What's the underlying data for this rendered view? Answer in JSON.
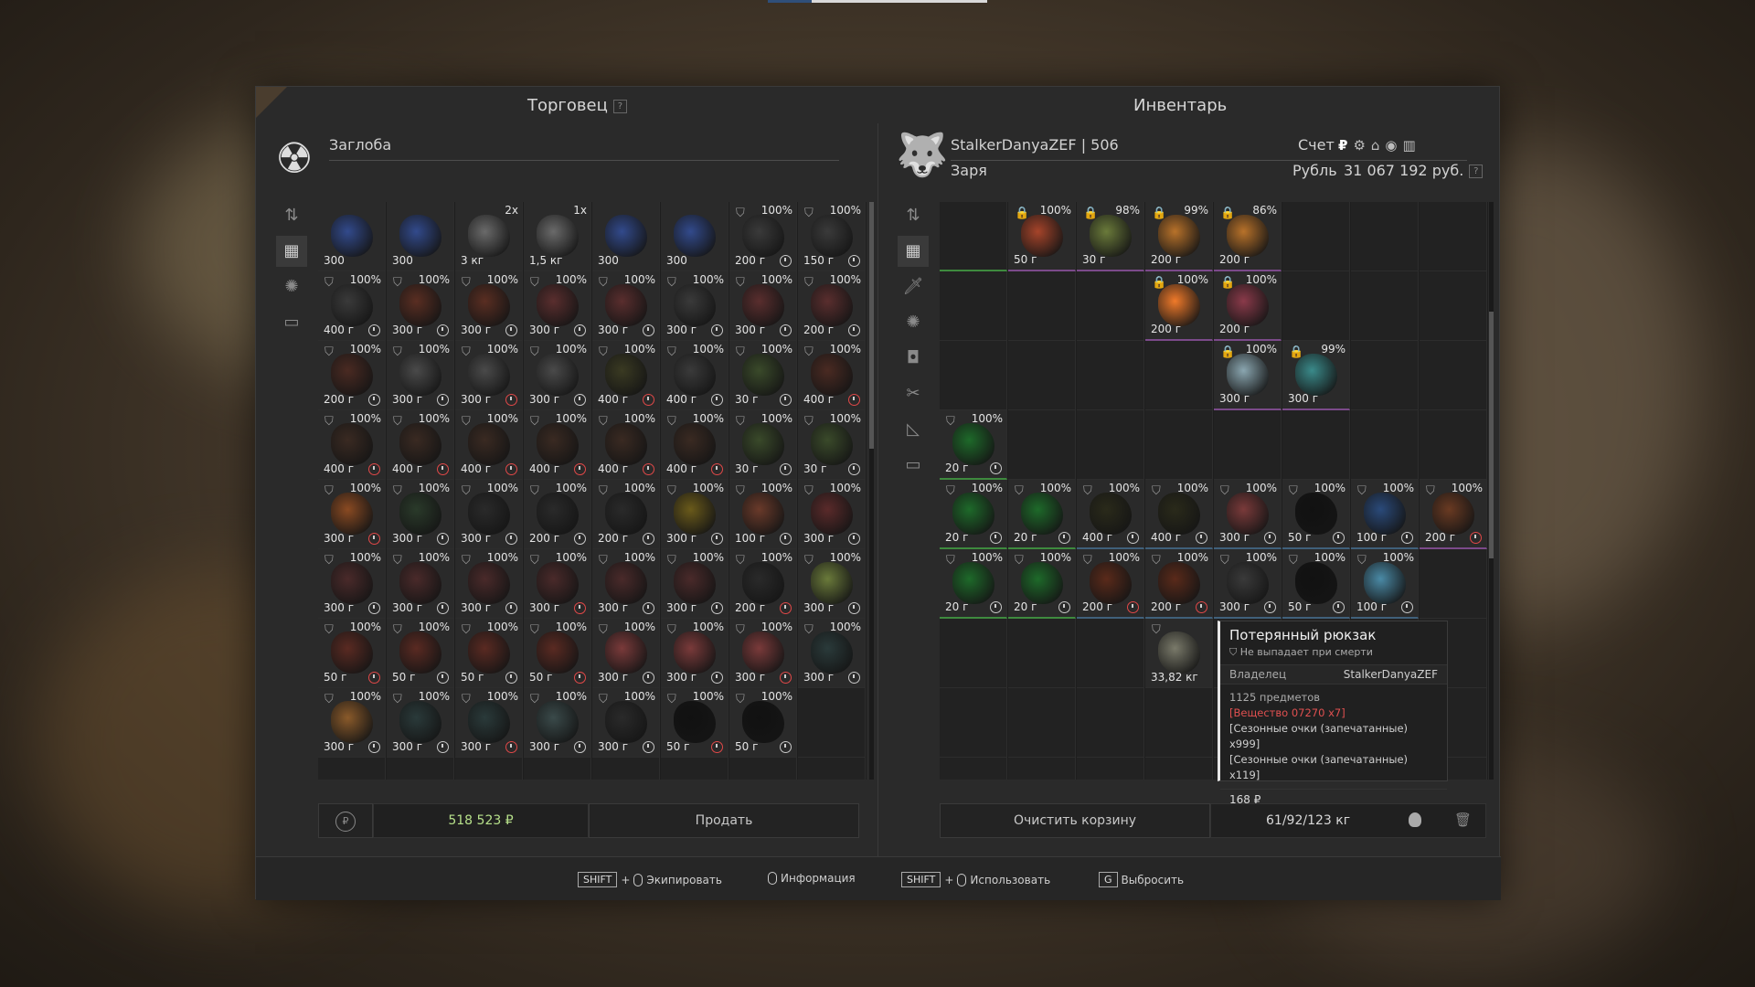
{
  "top_tabs": {
    "left_color": "#2f4f7a",
    "right_color": "#d9d9d9"
  },
  "trader": {
    "panel_title": "Торговец",
    "help": "?",
    "name": "Заглоба",
    "avatar_icon": "radiation-icon",
    "money": "518 523 ₽",
    "sell_label": "Продать",
    "side_icons": [
      "sort-icon",
      "grid-icon",
      "artifact-icon",
      "box-icon"
    ],
    "items": [
      {
        "pct": "",
        "wt": "300",
        "shield": false,
        "color": "#324a8c",
        "clock": ""
      },
      {
        "pct": "",
        "wt": "300",
        "shield": false,
        "color": "#324a8c",
        "clock": ""
      },
      {
        "pct": "2x",
        "wt": "3 кг",
        "shield": false,
        "color": "#6a6a6a",
        "clock": ""
      },
      {
        "pct": "1x",
        "wt": "1,5 кг",
        "shield": false,
        "color": "#6a6a6a",
        "clock": ""
      },
      {
        "pct": "",
        "wt": "300",
        "shield": false,
        "color": "#324a8c",
        "clock": ""
      },
      {
        "pct": "",
        "wt": "300",
        "shield": false,
        "color": "#324a8c",
        "clock": ""
      },
      {
        "pct": "100%",
        "wt": "200 г",
        "shield": true,
        "color": "#3a3a3a",
        "clock": "w"
      },
      {
        "pct": "100%",
        "wt": "150 г",
        "shield": true,
        "color": "#3a3a3a",
        "clock": "w"
      },
      {
        "pct": "100%",
        "wt": "400 г",
        "shield": true,
        "color": "#3a3a3a",
        "clock": "w"
      },
      {
        "pct": "100%",
        "wt": "300 г",
        "shield": true,
        "color": "#5a2e22",
        "clock": "w"
      },
      {
        "pct": "100%",
        "wt": "300 г",
        "shield": true,
        "color": "#5a2e22",
        "clock": "w"
      },
      {
        "pct": "100%",
        "wt": "300 г",
        "shield": true,
        "color": "#5a2e2e",
        "clock": "w"
      },
      {
        "pct": "100%",
        "wt": "300 г",
        "shield": true,
        "color": "#5a2e2e",
        "clock": "w"
      },
      {
        "pct": "100%",
        "wt": "300 г",
        "shield": true,
        "color": "#3a3a3a",
        "clock": "w"
      },
      {
        "pct": "100%",
        "wt": "300 г",
        "shield": true,
        "color": "#5a2e2e",
        "clock": "w"
      },
      {
        "pct": "100%",
        "wt": "200 г",
        "shield": true,
        "color": "#5a2e2e",
        "clock": "w"
      },
      {
        "pct": "100%",
        "wt": "200 г",
        "shield": true,
        "color": "#4a2a22",
        "clock": "w"
      },
      {
        "pct": "100%",
        "wt": "300 г",
        "shield": true,
        "color": "#4a4a4a",
        "clock": "w"
      },
      {
        "pct": "100%",
        "wt": "300 г",
        "shield": true,
        "color": "#4a4a4a",
        "clock": "r"
      },
      {
        "pct": "100%",
        "wt": "300 г",
        "shield": true,
        "color": "#4a4a4a",
        "clock": "w"
      },
      {
        "pct": "100%",
        "wt": "400 г",
        "shield": true,
        "color": "#3a3a22",
        "clock": "r"
      },
      {
        "pct": "100%",
        "wt": "400 г",
        "shield": true,
        "color": "#3a3a3a",
        "clock": "w"
      },
      {
        "pct": "100%",
        "wt": "30 г",
        "shield": true,
        "color": "#3a4a2a",
        "clock": "w"
      },
      {
        "pct": "100%",
        "wt": "400 г",
        "shield": true,
        "color": "#4a2a22",
        "clock": "r"
      },
      {
        "pct": "100%",
        "wt": "400 г",
        "shield": true,
        "color": "#3a2a22",
        "clock": "r"
      },
      {
        "pct": "100%",
        "wt": "400 г",
        "shield": true,
        "color": "#3a2a22",
        "clock": "r"
      },
      {
        "pct": "100%",
        "wt": "400 г",
        "shield": true,
        "color": "#3a2a22",
        "clock": "r"
      },
      {
        "pct": "100%",
        "wt": "400 г",
        "shield": true,
        "color": "#3a2a22",
        "clock": "r"
      },
      {
        "pct": "100%",
        "wt": "400 г",
        "shield": true,
        "color": "#3a2a22",
        "clock": "r"
      },
      {
        "pct": "100%",
        "wt": "400 г",
        "shield": true,
        "color": "#3a2a22",
        "clock": "r"
      },
      {
        "pct": "100%",
        "wt": "30 г",
        "shield": true,
        "color": "#3a4a2a",
        "clock": "w"
      },
      {
        "pct": "100%",
        "wt": "30 г",
        "shield": true,
        "color": "#3a4a2a",
        "clock": "w"
      },
      {
        "pct": "100%",
        "wt": "300 г",
        "shield": true,
        "color": "#8a4a22",
        "clock": "r"
      },
      {
        "pct": "100%",
        "wt": "300 г",
        "shield": true,
        "color": "#2a3a2a",
        "clock": "w"
      },
      {
        "pct": "100%",
        "wt": "300 г",
        "shield": true,
        "color": "#2a2a2a",
        "clock": "w"
      },
      {
        "pct": "100%",
        "wt": "200 г",
        "shield": true,
        "color": "#2a2a2a",
        "clock": "w"
      },
      {
        "pct": "100%",
        "wt": "200 г",
        "shield": true,
        "color": "#2a2a2a",
        "clock": "w"
      },
      {
        "pct": "100%",
        "wt": "300 г",
        "shield": true,
        "color": "#6a5a1a",
        "clock": "w"
      },
      {
        "pct": "100%",
        "wt": "100 г",
        "shield": true,
        "color": "#6a3a2a",
        "clock": "w"
      },
      {
        "pct": "100%",
        "wt": "300 г",
        "shield": true,
        "color": "#5a2a2a",
        "clock": "w"
      },
      {
        "pct": "100%",
        "wt": "300 г",
        "shield": true,
        "color": "#4a2a2a",
        "clock": "w"
      },
      {
        "pct": "100%",
        "wt": "300 г",
        "shield": true,
        "color": "#4a2a2a",
        "clock": "w"
      },
      {
        "pct": "100%",
        "wt": "300 г",
        "shield": true,
        "color": "#4a2a2a",
        "clock": "w"
      },
      {
        "pct": "100%",
        "wt": "300 г",
        "shield": true,
        "color": "#4a2a2a",
        "clock": "r"
      },
      {
        "pct": "100%",
        "wt": "300 г",
        "shield": true,
        "color": "#4a2a2a",
        "clock": "w"
      },
      {
        "pct": "100%",
        "wt": "300 г",
        "shield": true,
        "color": "#4a2a2a",
        "clock": "w"
      },
      {
        "pct": "100%",
        "wt": "200 г",
        "shield": true,
        "color": "#2a2a2a",
        "clock": "r"
      },
      {
        "pct": "100%",
        "wt": "300 г",
        "shield": true,
        "color": "#6a7a3a",
        "clock": "w"
      },
      {
        "pct": "100%",
        "wt": "50 г",
        "shield": true,
        "color": "#5a2a22",
        "clock": "r"
      },
      {
        "pct": "100%",
        "wt": "50 г",
        "shield": true,
        "color": "#5a2a22",
        "clock": "w"
      },
      {
        "pct": "100%",
        "wt": "50 г",
        "shield": true,
        "color": "#5a2a22",
        "clock": "w"
      },
      {
        "pct": "100%",
        "wt": "50 г",
        "shield": true,
        "color": "#5a2a22",
        "clock": "r"
      },
      {
        "pct": "100%",
        "wt": "300 г",
        "shield": true,
        "color": "#7a3a3a",
        "clock": "w"
      },
      {
        "pct": "100%",
        "wt": "300 г",
        "shield": true,
        "color": "#7a3a3a",
        "clock": "w"
      },
      {
        "pct": "100%",
        "wt": "300 г",
        "shield": true,
        "color": "#7a3a3a",
        "clock": "r"
      },
      {
        "pct": "100%",
        "wt": "300 г",
        "shield": true,
        "color": "#2a3a3a",
        "clock": "w"
      },
      {
        "pct": "100%",
        "wt": "300 г",
        "shield": true,
        "color": "#8a5a2a",
        "clock": "w"
      },
      {
        "pct": "100%",
        "wt": "300 г",
        "shield": true,
        "color": "#2a3a3a",
        "clock": "w"
      },
      {
        "pct": "100%",
        "wt": "300 г",
        "shield": true,
        "color": "#2a3a3a",
        "clock": "r"
      },
      {
        "pct": "100%",
        "wt": "300 г",
        "shield": true,
        "color": "#3a4a4a",
        "clock": "w"
      },
      {
        "pct": "100%",
        "wt": "300 г",
        "shield": true,
        "color": "#2a2a2a",
        "clock": "w"
      },
      {
        "pct": "100%",
        "wt": "50 г",
        "shield": true,
        "color": "#111111",
        "clock": "r"
      },
      {
        "pct": "100%",
        "wt": "50 г",
        "shield": true,
        "color": "#111111",
        "clock": "w"
      },
      {
        "pct": "",
        "wt": "",
        "shield": false,
        "color": "",
        "clock": ""
      }
    ]
  },
  "inventory": {
    "panel_title": "Инвентарь",
    "player": "StalkerDanyaZEF | 506",
    "faction": "Заря",
    "account_label": "Счет",
    "currency_label": "Рубль",
    "balance": "31 067 192 руб.",
    "help": "?",
    "avatar_icon": "wolf-icon",
    "currency_icons": [
      "ruble-icon",
      "gear-icon",
      "boot-icon",
      "coin-icon",
      "bars-icon"
    ],
    "side_icons": [
      "sort-icon",
      "grid-icon",
      "knife-icon",
      "artifact-icon",
      "camera-icon",
      "tools-icon",
      "chart-icon",
      "box-icon"
    ],
    "clear_cart_label": "Очистить корзину",
    "weight": "61/92/123 кг",
    "weight_icon": "kettlebell-icon",
    "trash_icon": "trash-icon",
    "cells": [
      {
        "pct": "",
        "wt": "",
        "lock": false,
        "color": "",
        "clock": "",
        "under": "g"
      },
      {
        "pct": "100%",
        "wt": "50 г",
        "lock": true,
        "color": "#a6442a",
        "clock": "",
        "under": "p"
      },
      {
        "pct": "98%",
        "wt": "30 г",
        "lock": true,
        "color": "#6a7a3a",
        "clock": "",
        "under": "p"
      },
      {
        "pct": "99%",
        "wt": "200 г",
        "lock": true,
        "color": "#b8722a",
        "clock": "",
        "under": "p"
      },
      {
        "pct": "86%",
        "wt": "200 г",
        "lock": true,
        "color": "#b8722a",
        "clock": "",
        "under": "p"
      },
      {},
      {},
      {},
      {},
      {},
      {},
      {
        "pct": "100%",
        "wt": "200 г",
        "lock": true,
        "color": "#f07a2a",
        "clock": "",
        "under": "p"
      },
      {
        "pct": "100%",
        "wt": "200 г",
        "lock": true,
        "color": "#8a3a4a",
        "clock": "",
        "under": "p"
      },
      {},
      {},
      {},
      {},
      {},
      {},
      {},
      {
        "pct": "100%",
        "wt": "300 г",
        "lock": true,
        "color": "#8aa6b0",
        "clock": "",
        "under": "p"
      },
      {
        "pct": "99%",
        "wt": "300 г",
        "lock": true,
        "color": "#3a8a8a",
        "clock": "",
        "under": "p"
      },
      {},
      {},
      {
        "pct": "100%",
        "wt": "20 г",
        "shield": true,
        "color": "#1e6a2a",
        "clock": "w",
        "under": "g"
      },
      {},
      {},
      {},
      {},
      {},
      {},
      {},
      {
        "pct": "100%",
        "wt": "20 г",
        "shield": true,
        "color": "#1e6a2a",
        "clock": "w",
        "under": "g"
      },
      {
        "pct": "100%",
        "wt": "20 г",
        "shield": true,
        "color": "#1e6a2a",
        "clock": "w",
        "under": "g"
      },
      {
        "pct": "100%",
        "wt": "400 г",
        "shield": true,
        "color": "#2a2a1a",
        "clock": "w",
        "under": "b"
      },
      {
        "pct": "100%",
        "wt": "400 г",
        "shield": true,
        "color": "#2a2a1a",
        "clock": "w",
        "under": "b"
      },
      {
        "pct": "100%",
        "wt": "300 г",
        "shield": true,
        "color": "#7a3a3a",
        "clock": "w",
        "under": "b"
      },
      {
        "pct": "100%",
        "wt": "50 г",
        "shield": true,
        "color": "#111111",
        "clock": "w",
        "under": "b"
      },
      {
        "pct": "100%",
        "wt": "100 г",
        "shield": true,
        "color": "#2a4a7a",
        "clock": "w",
        "under": "b"
      },
      {
        "pct": "100%",
        "wt": "200 г",
        "shield": true,
        "color": "#6a3a22",
        "clock": "r",
        "under": "p"
      },
      {
        "pct": "100%",
        "wt": "20 г",
        "shield": true,
        "color": "#1e6a2a",
        "clock": "w",
        "under": "g"
      },
      {
        "pct": "100%",
        "wt": "20 г",
        "shield": true,
        "color": "#1e6a2a",
        "clock": "w",
        "under": "g"
      },
      {
        "pct": "100%",
        "wt": "200 г",
        "shield": true,
        "color": "#5a2a1a",
        "clock": "r",
        "under": "b"
      },
      {
        "pct": "100%",
        "wt": "200 г",
        "shield": true,
        "color": "#5a2a1a",
        "clock": "r",
        "under": "b"
      },
      {
        "pct": "100%",
        "wt": "300 г",
        "shield": true,
        "color": "#3a3a3a",
        "clock": "w",
        "under": "b"
      },
      {
        "pct": "100%",
        "wt": "50 г",
        "shield": true,
        "color": "#111111",
        "clock": "w",
        "under": "b"
      },
      {
        "pct": "100%",
        "wt": "100 г",
        "shield": true,
        "color": "#4a8aa6",
        "clock": "w",
        "under": "b"
      },
      {},
      {},
      {},
      {},
      {
        "pct": "",
        "wt": "33,82 кг",
        "shield": true,
        "color": "#7a7a6a",
        "clock": "",
        "under": ""
      },
      {},
      {},
      {},
      {},
      {},
      {},
      {},
      {},
      {},
      {},
      {},
      {}
    ]
  },
  "tooltip": {
    "title": "Потерянный рюкзак",
    "subtitle": "Не выпадает при смерти",
    "owner_label": "Владелец",
    "owner_value": "StalkerDanyaZEF",
    "count": "1125 предметов",
    "line_red": "[Вещество 07270 x7]",
    "line2": "[Сезонные очки (запечатанные) x999]",
    "line3": "[Сезонные очки (запечатанные) x119]",
    "price": "168 ₽"
  },
  "hints": {
    "shift": "SHIFT",
    "plus": "+",
    "equip": "Экипировать",
    "info": "Информация",
    "use": "Использовать",
    "drop_key": "G",
    "drop": "Выбросить"
  }
}
